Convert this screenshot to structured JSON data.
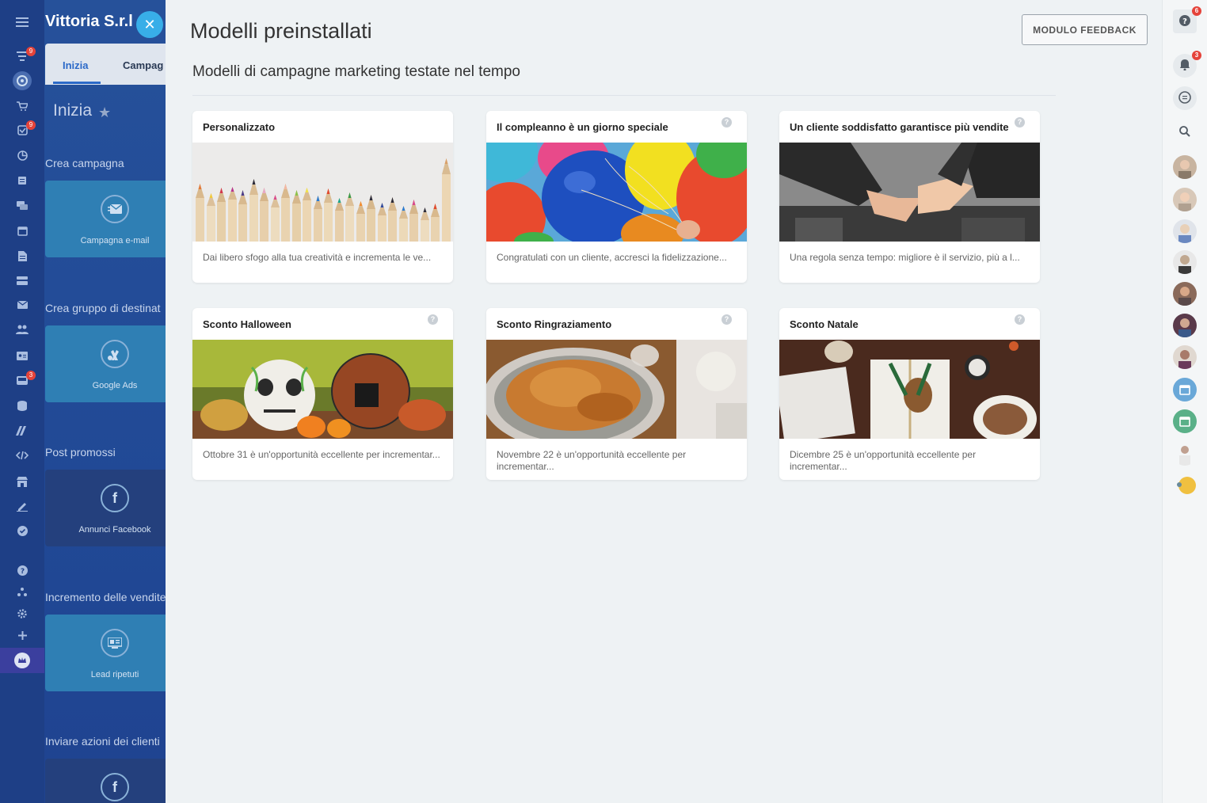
{
  "rail": {
    "badges": {
      "filter": "9",
      "tasks": "9",
      "inbox": "3"
    }
  },
  "panel": {
    "company": "Vittoria S.r.l",
    "tabs": [
      "Inizia",
      "Campag"
    ],
    "heading": "Inizia",
    "sections": [
      {
        "label": "Crea campagna",
        "tile": "Campagna e-mail",
        "icon": "email-icon"
      },
      {
        "label": "Crea gruppo di destinat",
        "tile": "Google Ads",
        "icon": "google-ads-icon"
      },
      {
        "label": "Post promossi",
        "tile": "Annunci Facebook",
        "icon": "facebook-icon"
      },
      {
        "label": "Incremento delle vendite",
        "tile": "Lead ripetuti",
        "icon": "lead-icon"
      },
      {
        "label": "Inviare azioni dei clienti",
        "tile": "",
        "icon": "facebook-icon"
      }
    ]
  },
  "main": {
    "title": "Modelli preinstallati",
    "subtitle": "Modelli di campagne marketing testate nel tempo",
    "feedback_label": "MODULO FEEDBACK",
    "cards": [
      {
        "title": "Personalizzato",
        "desc": "Dai libero sfogo alla tua creatività e incrementa le ve...",
        "image": "colored-pencils"
      },
      {
        "title": "Il compleanno è un giorno speciale",
        "desc": "Congratulati con un cliente, accresci la fidelizzazione...",
        "image": "balloons"
      },
      {
        "title": "Un cliente soddisfatto garantisce più vendite",
        "desc": "Una regola senza tempo: migliore è il servizio, più a l...",
        "image": "handshake"
      },
      {
        "title": "Sconto Halloween",
        "desc": "Ottobre 31 è un'opportunità eccellente per incrementar...",
        "image": "pumpkins"
      },
      {
        "title": "Sconto Ringraziamento",
        "desc": "Novembre 22 è un'opportunità eccellente per incrementar...",
        "image": "roast-turkey"
      },
      {
        "title": "Sconto Natale",
        "desc": "Dicembre 25 è un'opportunità eccellente per incrementar...",
        "image": "christmas-gift"
      }
    ]
  },
  "rightbar": {
    "help_badge": "6",
    "notifications_badge": "3"
  }
}
